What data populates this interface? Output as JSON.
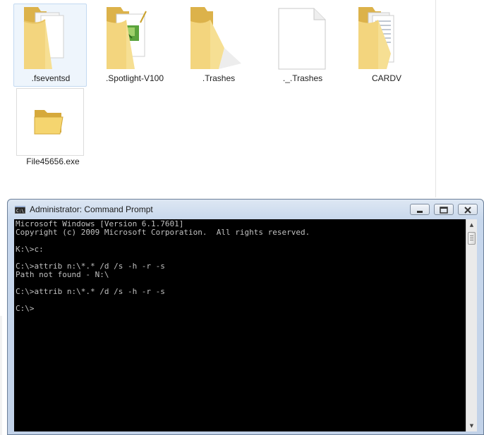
{
  "explorer": {
    "items": [
      {
        "label": ".fseventsd",
        "icon": "folder-documents-icon",
        "selected": true
      },
      {
        "label": ".Spotlight-V100",
        "icon": "folder-image-icon",
        "selected": false
      },
      {
        "label": ".Trashes",
        "icon": "folder-icon",
        "selected": false
      },
      {
        "label": "._.Trashes",
        "icon": "blank-file-icon",
        "selected": false
      },
      {
        "label": "CARDV",
        "icon": "folder-files-icon",
        "selected": false
      },
      {
        "label": "File45656.exe",
        "icon": "exe-folder-icon",
        "selected": false
      }
    ]
  },
  "console": {
    "title": "Administrator: Command Prompt",
    "text": "Microsoft Windows [Version 6.1.7601]\nCopyright (c) 2009 Microsoft Corporation.  All rights reserved.\n\nK:\\>c:\n\nC:\\>attrib n:\\*.* /d /s -h -r -s\nPath not found - N:\\\n\nC:\\>attrib n:\\*.* /d /s -h -r -s\n\nC:\\>",
    "icon": "cmd-icon",
    "colors": {
      "background": "#000000",
      "foreground": "#c0c0c0"
    }
  },
  "icons": {
    "minimize": "minimize-icon",
    "maximize": "maximize-icon",
    "close": "close-icon",
    "scroll_up": "scroll-up-icon",
    "scroll_down": "scroll-down-icon"
  }
}
